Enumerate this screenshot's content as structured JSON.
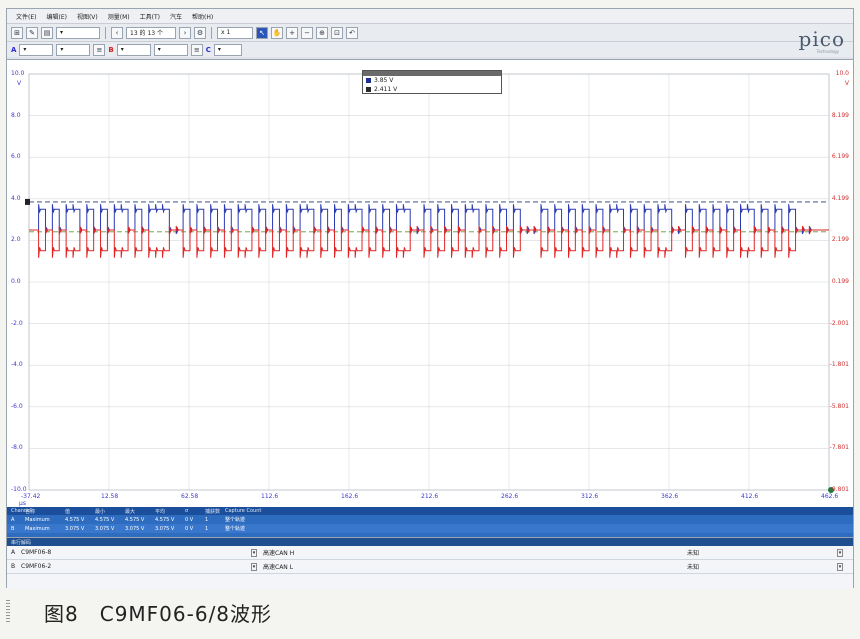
{
  "menu": [
    "文件(E)",
    "编辑(E)",
    "视图(V)",
    "测量(M)",
    "工具(T)",
    "汽车",
    "帮助(H)"
  ],
  "toolbar1": {
    "capture_count": "13 的 13 个",
    "zoom": "x 1"
  },
  "toolbar2": {
    "channel_a": "A",
    "channel_b": "B",
    "channel_c": "C"
  },
  "logo": "pico",
  "logo_sub": "Technology",
  "y_left_ticks": [
    "10.0",
    "8.0",
    "6.0",
    "4.0",
    "2.0",
    "0.0",
    "-2.0",
    "-4.0",
    "-6.0",
    "-8.0",
    "-10.0"
  ],
  "y_left_unit": "V",
  "y_right_ticks": [
    "10.0",
    "8.199",
    "6.199",
    "4.199",
    "2.199",
    "0.199",
    "-2.001",
    "-1.801",
    "-5.801",
    "-7.801",
    "-9.801"
  ],
  "y_right_unit": "V",
  "x_ticks": [
    "-37.42",
    "12.58",
    "62.58",
    "112.6",
    "162.6",
    "212.6",
    "262.6",
    "312.6",
    "362.6",
    "412.6",
    "462.6"
  ],
  "x_unit": "μs",
  "rulers": [
    {
      "label": "3.85 V",
      "color": "#1f2f8f"
    },
    {
      "label": "2.411 V",
      "color": "#2a2a2a"
    }
  ],
  "colors": {
    "can_h": "#2a3ab0",
    "can_l": "#e02424",
    "ruler_top": "#1f3a7a",
    "ruler_bottom": "#5c9a3a",
    "grid": "#d6d9de"
  },
  "chart_data": {
    "type": "line",
    "title": "",
    "xlabel": "μs",
    "ylabel": "V",
    "xlim": [
      -37.42,
      462.6
    ],
    "ylim": [
      -10,
      10
    ],
    "series": [
      {
        "name": "",
        "color": "#2a3ab0",
        "recessive_level": 2.5,
        "dominant_level": 3.5
      },
      {
        "name": "",
        "color": "#e02424",
        "recessive_level": 2.5,
        "dominant_level": 1.5
      }
    ],
    "rulers": [
      3.85,
      2.411
    ],
    "bit_pattern": [
      1,
      0,
      1,
      0,
      1,
      1,
      0,
      1,
      0,
      1,
      0,
      1,
      1,
      0,
      1,
      0,
      1,
      1,
      1,
      0,
      0,
      1,
      0,
      1,
      0,
      1,
      0,
      1,
      0,
      1,
      1,
      0,
      1,
      0,
      1,
      0,
      1,
      0,
      1,
      1,
      0,
      1,
      0,
      1,
      0,
      1,
      1,
      0,
      1,
      0,
      1,
      0,
      1,
      1,
      0,
      0,
      1,
      0,
      1,
      0,
      1,
      0,
      1,
      1,
      0,
      1,
      0,
      1,
      0,
      1,
      0,
      0,
      0,
      1,
      0,
      1,
      0,
      1,
      0,
      1,
      0,
      1,
      0,
      1,
      1,
      0,
      1,
      0,
      1,
      0,
      1,
      1,
      0,
      0,
      1,
      0,
      1,
      0,
      1,
      0,
      1,
      0,
      1,
      1,
      0,
      1,
      0,
      1,
      0,
      1,
      0,
      0,
      0
    ]
  },
  "measurements": {
    "headers": [
      "Channel",
      "名称",
      "值",
      "最小",
      "最大",
      "平均",
      "σ",
      "捕获数",
      "Capture Count"
    ],
    "rows": [
      [
        "A",
        "Maximum",
        "4.575 V",
        "4.575 V",
        "4.575 V",
        "4.575 V",
        "0 V",
        "1",
        "整个轨迹"
      ],
      [
        "B",
        "Maximum",
        "3.075 V",
        "3.075 V",
        "3.075 V",
        "3.075 V",
        "0 V",
        "1",
        "整个轨迹"
      ]
    ]
  },
  "decode": {
    "title": "串行解码",
    "rows": [
      {
        "channel": "A",
        "name": "C9MF06-8",
        "protocol": "高速CAN H",
        "status": "未知"
      },
      {
        "channel": "B",
        "name": "C9MF06-2",
        "protocol": "高速CAN L",
        "status": "未知"
      }
    ]
  },
  "caption": "图8　C9MF06-6/8波形"
}
